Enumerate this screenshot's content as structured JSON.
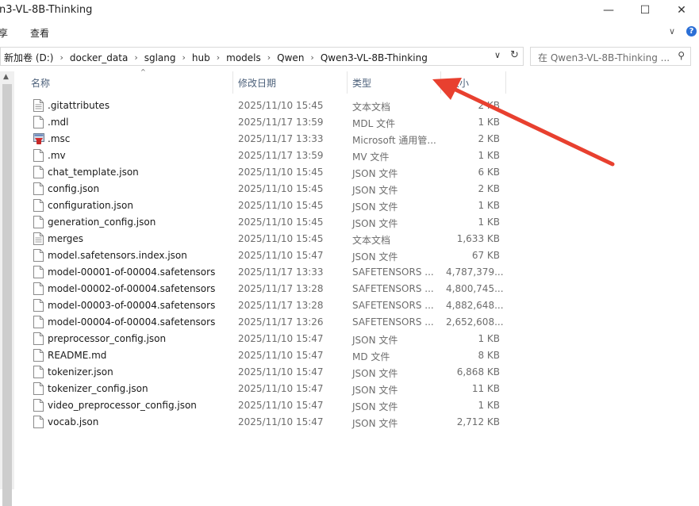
{
  "window": {
    "title": "n3-VL-8B-Thinking",
    "minimize_glyph": "—",
    "maximize_glyph": "☐",
    "close_glyph": "✕"
  },
  "ribbon": {
    "tabs": [
      "享",
      "查看"
    ],
    "collapse_glyph": "∨",
    "help_glyph": "?"
  },
  "address": {
    "crumbs": [
      "新加卷 (D:)",
      "docker_data",
      "sglang",
      "hub",
      "models",
      "Qwen",
      "Qwen3-VL-8B-Thinking"
    ],
    "separator": "›",
    "dropdown_glyph": "∨",
    "refresh_glyph": "↻"
  },
  "search": {
    "placeholder": "在 Qwen3-VL-8B-Thinking ...",
    "icon_glyph": "⚲"
  },
  "columns": {
    "name": "名称",
    "date": "修改日期",
    "type": "类型",
    "size": "大小"
  },
  "scroll_up_glyph": "▲",
  "sort_glyph": "^",
  "files": [
    {
      "name": ".gitattributes",
      "date": "2025/11/10 15:45",
      "type": "文本文档",
      "size": "2 KB",
      "icon": "text-document-icon"
    },
    {
      "name": ".mdl",
      "date": "2025/11/17 13:59",
      "type": "MDL 文件",
      "size": "1 KB",
      "icon": "file-icon"
    },
    {
      "name": ".msc",
      "date": "2025/11/17 13:33",
      "type": "Microsoft 通用管...",
      "size": "2 KB",
      "icon": "msc-console-icon"
    },
    {
      "name": ".mv",
      "date": "2025/11/17 13:59",
      "type": "MV 文件",
      "size": "1 KB",
      "icon": "file-icon"
    },
    {
      "name": "chat_template.json",
      "date": "2025/11/10 15:45",
      "type": "JSON 文件",
      "size": "6 KB",
      "icon": "file-icon"
    },
    {
      "name": "config.json",
      "date": "2025/11/10 15:45",
      "type": "JSON 文件",
      "size": "2 KB",
      "icon": "file-icon"
    },
    {
      "name": "configuration.json",
      "date": "2025/11/10 15:45",
      "type": "JSON 文件",
      "size": "1 KB",
      "icon": "file-icon"
    },
    {
      "name": "generation_config.json",
      "date": "2025/11/10 15:45",
      "type": "JSON 文件",
      "size": "1 KB",
      "icon": "file-icon"
    },
    {
      "name": "merges",
      "date": "2025/11/10 15:45",
      "type": "文本文档",
      "size": "1,633 KB",
      "icon": "text-document-icon"
    },
    {
      "name": "model.safetensors.index.json",
      "date": "2025/11/10 15:47",
      "type": "JSON 文件",
      "size": "67 KB",
      "icon": "file-icon"
    },
    {
      "name": "model-00001-of-00004.safetensors",
      "date": "2025/11/17 13:33",
      "type": "SAFETENSORS ...",
      "size": "4,787,379...",
      "icon": "file-icon"
    },
    {
      "name": "model-00002-of-00004.safetensors",
      "date": "2025/11/17 13:28",
      "type": "SAFETENSORS ...",
      "size": "4,800,745...",
      "icon": "file-icon"
    },
    {
      "name": "model-00003-of-00004.safetensors",
      "date": "2025/11/17 13:28",
      "type": "SAFETENSORS ...",
      "size": "4,882,648...",
      "icon": "file-icon"
    },
    {
      "name": "model-00004-of-00004.safetensors",
      "date": "2025/11/17 13:26",
      "type": "SAFETENSORS ...",
      "size": "2,652,608...",
      "icon": "file-icon"
    },
    {
      "name": "preprocessor_config.json",
      "date": "2025/11/10 15:47",
      "type": "JSON 文件",
      "size": "1 KB",
      "icon": "file-icon"
    },
    {
      "name": "README.md",
      "date": "2025/11/10 15:47",
      "type": "MD 文件",
      "size": "8 KB",
      "icon": "file-icon"
    },
    {
      "name": "tokenizer.json",
      "date": "2025/11/10 15:47",
      "type": "JSON 文件",
      "size": "6,868 KB",
      "icon": "file-icon"
    },
    {
      "name": "tokenizer_config.json",
      "date": "2025/11/10 15:47",
      "type": "JSON 文件",
      "size": "11 KB",
      "icon": "file-icon"
    },
    {
      "name": "video_preprocessor_config.json",
      "date": "2025/11/10 15:47",
      "type": "JSON 文件",
      "size": "1 KB",
      "icon": "file-icon"
    },
    {
      "name": "vocab.json",
      "date": "2025/11/10 15:47",
      "type": "JSON 文件",
      "size": "2,712 KB",
      "icon": "file-icon"
    }
  ],
  "annotation": {
    "color": "#e8402f",
    "icon": "red-arrow-annotation"
  }
}
